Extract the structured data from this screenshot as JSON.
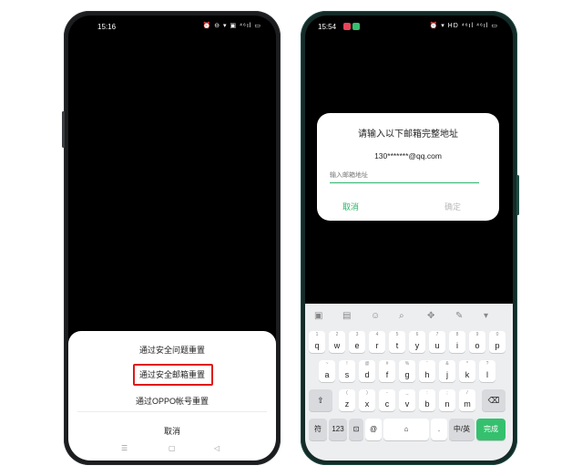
{
  "left_phone": {
    "status_time": "15:16",
    "status_icons": "⏰ ⊖ ▾ ▣ ⁴⁶ıl ▭",
    "sheet": {
      "option_1": "通过安全问题重置",
      "option_2": "通过安全邮箱重置",
      "option_3": "通过OPPO帐号重置",
      "cancel": "取消"
    },
    "nav": {
      "menu": "☰",
      "home": "▢",
      "back": "◁"
    }
  },
  "right_phone": {
    "status_time": "15:54",
    "status_icons": "⏰ ▾ HD ⁴⁶ıl ⁴⁶ıl ▭",
    "dialog": {
      "title": "请输入以下邮箱完整地址",
      "email": "130*******@qq.com",
      "input_placeholder": "输入邮箱地址",
      "cancel": "取消",
      "confirm": "确定"
    },
    "keyboard": {
      "toolbar": [
        "▣",
        "▤",
        "☺",
        "⌕",
        "✥",
        "✎",
        "▾"
      ],
      "row1": [
        {
          "num": "1",
          "ch": "q"
        },
        {
          "num": "2",
          "ch": "w"
        },
        {
          "num": "3",
          "ch": "e"
        },
        {
          "num": "4",
          "ch": "r"
        },
        {
          "num": "5",
          "ch": "t"
        },
        {
          "num": "6",
          "ch": "y"
        },
        {
          "num": "7",
          "ch": "u"
        },
        {
          "num": "8",
          "ch": "i"
        },
        {
          "num": "9",
          "ch": "o"
        },
        {
          "num": "0",
          "ch": "p"
        }
      ],
      "row2": [
        {
          "num": "~",
          "ch": "a"
        },
        {
          "num": "!",
          "ch": "s"
        },
        {
          "num": "@",
          "ch": "d"
        },
        {
          "num": "#",
          "ch": "f"
        },
        {
          "num": "%",
          "ch": "g"
        },
        {
          "num": "'",
          "ch": "h"
        },
        {
          "num": "&",
          "ch": "j"
        },
        {
          "num": "*",
          "ch": "k"
        },
        {
          "num": "?",
          "ch": "l"
        }
      ],
      "row3": [
        {
          "num": "(",
          "ch": "z"
        },
        {
          "num": ")",
          "ch": "x"
        },
        {
          "num": "-",
          "ch": "c"
        },
        {
          "num": "_",
          "ch": "v"
        },
        {
          "num": ":",
          "ch": "b"
        },
        {
          "num": ";",
          "ch": "n"
        },
        {
          "num": "/",
          "ch": "m"
        }
      ],
      "shift": "⇧",
      "delete": "⌫",
      "symbol": "符",
      "num_key": "123",
      "emoji_key": "⊡",
      "at_key": "@",
      "space": "⌂",
      "period": ".",
      "lang": "中/英",
      "done": "完成"
    }
  },
  "colors": {
    "accent": "#2fb26a",
    "highlight": "#e01818"
  }
}
